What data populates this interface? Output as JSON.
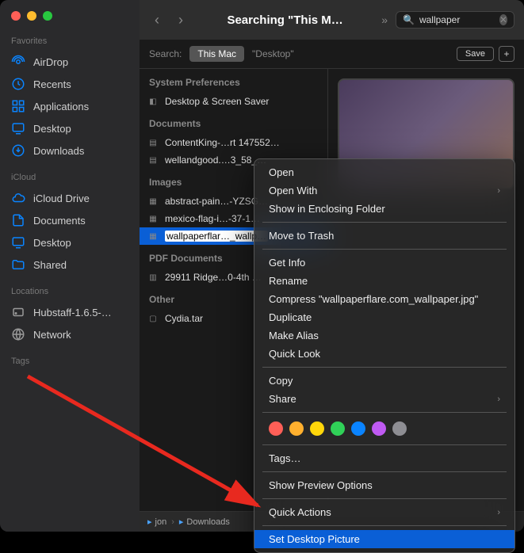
{
  "window_title": "Searching \"This M…",
  "search": {
    "value": "wallpaper",
    "placeholder": "Search"
  },
  "sidebar": {
    "favorites_label": "Favorites",
    "favorites": [
      {
        "label": "AirDrop",
        "icon": "airdrop"
      },
      {
        "label": "Recents",
        "icon": "clock"
      },
      {
        "label": "Applications",
        "icon": "apps"
      },
      {
        "label": "Desktop",
        "icon": "desktop"
      },
      {
        "label": "Downloads",
        "icon": "downloads"
      }
    ],
    "icloud_label": "iCloud",
    "icloud": [
      {
        "label": "iCloud Drive",
        "icon": "cloud"
      },
      {
        "label": "Documents",
        "icon": "doc"
      },
      {
        "label": "Desktop",
        "icon": "desktop"
      },
      {
        "label": "Shared",
        "icon": "folder"
      }
    ],
    "locations_label": "Locations",
    "locations": [
      {
        "label": "Hubstaff-1.6.5-…",
        "icon": "disk"
      },
      {
        "label": "Network",
        "icon": "globe"
      }
    ],
    "tags_label": "Tags"
  },
  "scope": {
    "label": "Search:",
    "active": "This Mac",
    "other": "\"Desktop\"",
    "save": "Save"
  },
  "groups": [
    {
      "name": "System Preferences",
      "files": [
        {
          "name": "Desktop & Screen Saver",
          "icon": "pref"
        }
      ]
    },
    {
      "name": "Documents",
      "files": [
        {
          "name": "ContentKing-…rt 147552…",
          "icon": "doc"
        },
        {
          "name": "wellandgood.…3_58_…",
          "icon": "doc"
        }
      ]
    },
    {
      "name": "Images",
      "files": [
        {
          "name": "abstract-pain…-YZSG…",
          "icon": "img"
        },
        {
          "name": "mexico-flag-i…-37-1…",
          "icon": "img"
        },
        {
          "name": "wallpaperflar…_wallp…",
          "icon": "img",
          "selected": true
        }
      ]
    },
    {
      "name": "PDF Documents",
      "files": [
        {
          "name": "29911 Ridge…0-4th …",
          "icon": "pdf"
        }
      ]
    },
    {
      "name": "Other",
      "files": [
        {
          "name": "Cydia.tar",
          "icon": "file"
        }
      ]
    }
  ],
  "pathbar": {
    "segments": [
      "jon",
      "Downloads"
    ]
  },
  "context_menu": {
    "groups": [
      [
        {
          "label": "Open"
        },
        {
          "label": "Open With",
          "sub": true
        },
        {
          "label": "Show in Enclosing Folder"
        }
      ],
      [
        {
          "label": "Move to Trash"
        }
      ],
      [
        {
          "label": "Get Info"
        },
        {
          "label": "Rename"
        },
        {
          "label": "Compress \"wallpaperflare.com_wallpaper.jpg\""
        },
        {
          "label": "Duplicate"
        },
        {
          "label": "Make Alias"
        },
        {
          "label": "Quick Look"
        }
      ],
      [
        {
          "label": "Copy"
        },
        {
          "label": "Share",
          "sub": true
        }
      ],
      "tags",
      [
        {
          "label": "Tags…"
        }
      ],
      [
        {
          "label": "Show Preview Options"
        }
      ],
      [
        {
          "label": "Quick Actions",
          "sub": true
        }
      ],
      [
        {
          "label": "Set Desktop Picture",
          "highlight": true
        }
      ]
    ],
    "tag_colors": [
      "#ff5f57",
      "#ffb02e",
      "#ffd60a",
      "#30d158",
      "#0a84ff",
      "#bf5af2",
      "#8e8e93"
    ]
  }
}
